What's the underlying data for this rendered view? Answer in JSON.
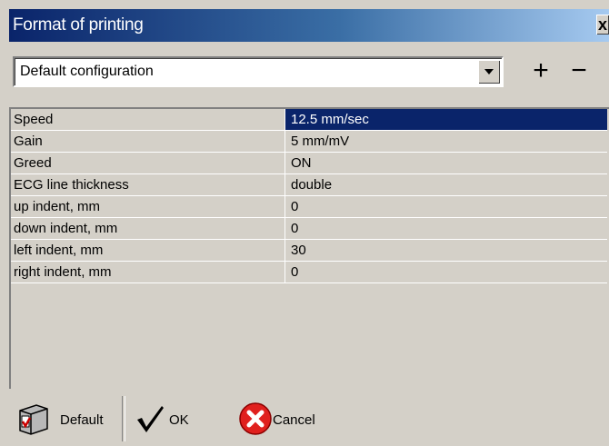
{
  "window": {
    "title": "Format of printing",
    "close_label": "x"
  },
  "config": {
    "selected": "Default configuration",
    "add_label": "+",
    "remove_label": "−"
  },
  "properties": [
    {
      "name": "Speed",
      "value": "12.5 mm/sec",
      "selected": true
    },
    {
      "name": "Gain",
      "value": "5 mm/mV"
    },
    {
      "name": "Greed",
      "value": "ON"
    },
    {
      "name": "ECG line thickness",
      "value": "double"
    },
    {
      "name": "up indent, mm",
      "value": "0"
    },
    {
      "name": "down indent, mm",
      "value": "0"
    },
    {
      "name": "left indent, mm",
      "value": "30"
    },
    {
      "name": "right indent, mm",
      "value": "0"
    }
  ],
  "toolbar": {
    "default_label": "Default",
    "ok_label": "OK",
    "cancel_label": "Cancel"
  },
  "colors": {
    "selection": "#0a246a",
    "dialog_bg": "#d4d0c8",
    "cancel_icon": "#e0201e"
  }
}
